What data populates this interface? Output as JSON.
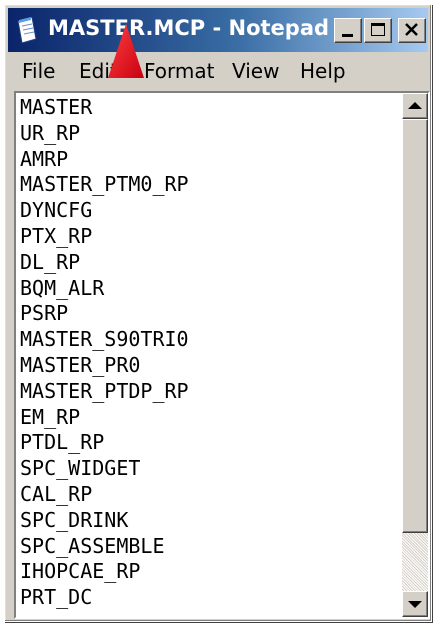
{
  "window": {
    "title": "MASTER.MCP - Notepad",
    "title_gradient": [
      "#0a246a",
      "#a6caf0"
    ]
  },
  "caption_buttons": {
    "minimize_icon": "minimize-icon",
    "maximize_icon": "maximize-icon",
    "close_icon": "close-icon"
  },
  "menu": {
    "items": [
      "File",
      "Edit",
      "Format",
      "View",
      "Help"
    ]
  },
  "editor": {
    "lines": [
      "MASTER",
      "UR_RP",
      "AMRP",
      "MASTER_PTM0_RP",
      "DYNCFG",
      "PTX_RP",
      "DL_RP",
      "BQM_ALR",
      "PSRP",
      "MASTER_S90TRI0",
      "MASTER_PR0",
      "MASTER_PTDP_RP",
      "EM_RP",
      "PTDL_RP",
      "SPC_WIDGET",
      "CAL_RP",
      "SPC_DRINK",
      "SPC_ASSEMBLE",
      "IHOPCAE_RP",
      "PRT_DC"
    ]
  },
  "annotation": {
    "icon": "red-triangle-pointer-icon",
    "color": "#e8141c"
  }
}
